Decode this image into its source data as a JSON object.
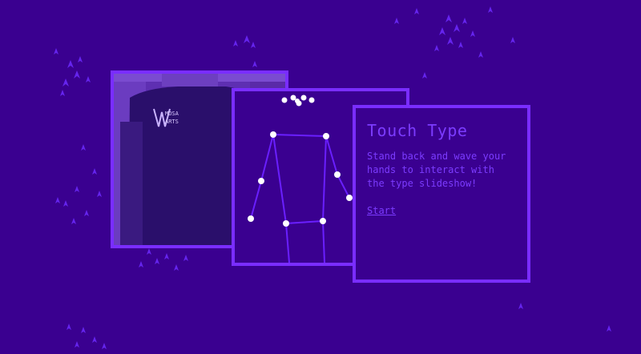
{
  "info_card": {
    "title": "Touch Type",
    "description": "Stand back and wave your hands to interact with the type slideshow!",
    "start_label": "Start"
  },
  "colors": {
    "background": "#3a0090",
    "accent": "#7a2dff",
    "text": "#7c3bff",
    "skeleton_line": "#6a1fff",
    "joint": "#ffffff"
  },
  "icons": {
    "camera": "webcam-photo",
    "skeleton": "pose-skeleton-icon"
  }
}
